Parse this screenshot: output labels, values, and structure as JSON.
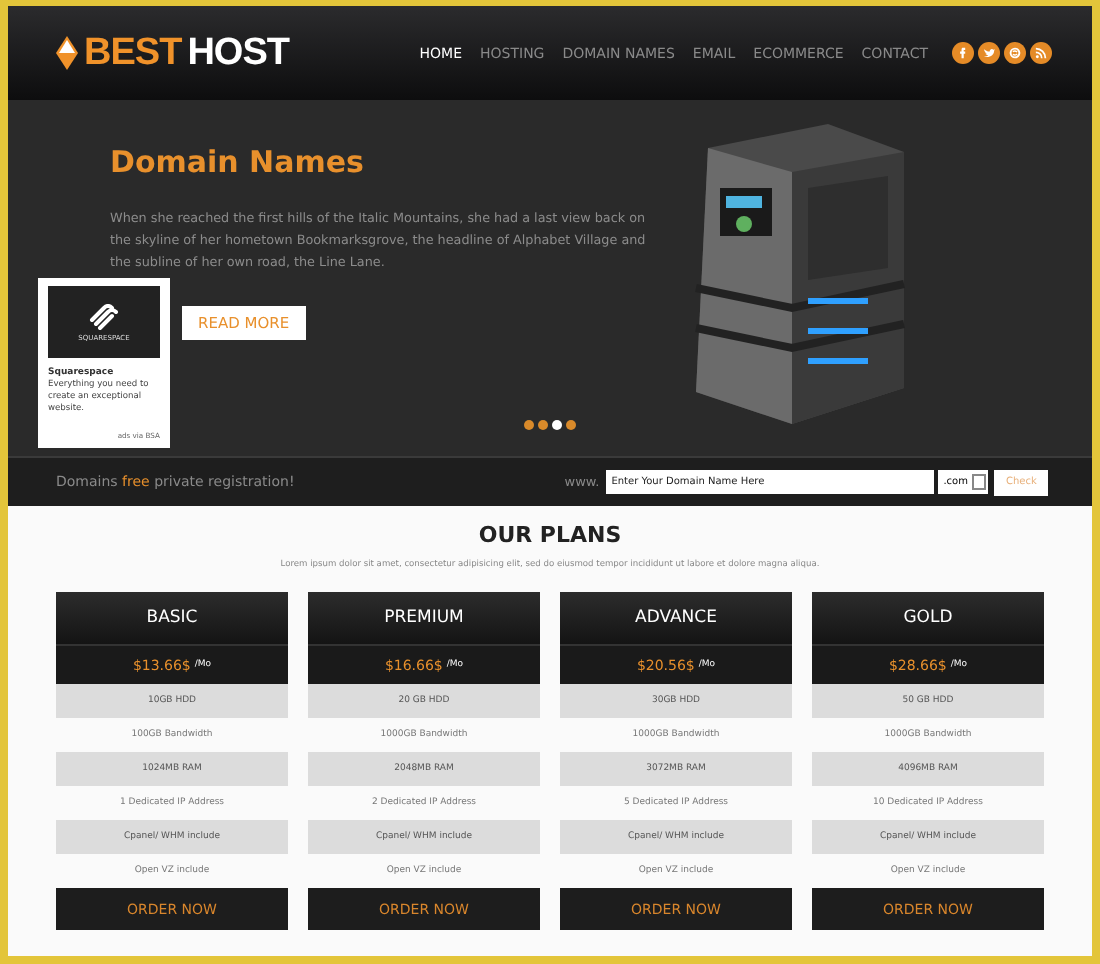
{
  "header": {
    "logo": {
      "accent": "BEST",
      "rest": "HOST"
    },
    "nav": [
      {
        "label": "HOME",
        "selected": true
      },
      {
        "label": "HOSTING",
        "selected": false
      },
      {
        "label": "DOMAIN NAMES",
        "selected": false
      },
      {
        "label": "EMAIL",
        "selected": false
      },
      {
        "label": "ECOMMERCE",
        "selected": false
      },
      {
        "label": "CONTACT",
        "selected": false
      }
    ],
    "social": [
      {
        "kind": "facebook"
      },
      {
        "kind": "twitter"
      },
      {
        "kind": "skype"
      },
      {
        "kind": "rss"
      }
    ]
  },
  "hero": {
    "title": "Domain Names",
    "text": "When she reached the first hills of the Italic Mountains, she had a last view back on the skyline of her hometown Bookmarksgrove, the headline of Alphabet Village and the subline of her own road, the Line Lane.",
    "button": "READ MORE",
    "dots": [
      {
        "selected": false
      },
      {
        "selected": false
      },
      {
        "selected": true
      },
      {
        "selected": false
      }
    ]
  },
  "ad": {
    "brand_mark": "SQUARESPACE",
    "title": "Squarespace",
    "text": "Everything you need to create an exceptional website.",
    "footer": "ads via BSA"
  },
  "domain_bar": {
    "text": "Domains **free** private registration!",
    "prefix": "www.",
    "placeholder": "Enter Your Domain Name Here",
    "tld": ".com",
    "button": "Check"
  },
  "plans_section": {
    "title": "OUR PLANS",
    "subtitle": "Lorem ipsum dolor sit amet, consectetur adipisicing elit, sed do eiusmod tempor incididunt ut labore et dolore magna aliqua.",
    "plans": [
      {
        "name": "BASIC",
        "price": "$13.66$",
        "period": "/Mo",
        "features": [
          {
            "kind": "shaded",
            "text": "10GB HDD"
          },
          {
            "kind": "plain",
            "text": "100GB Bandwidth"
          },
          {
            "kind": "shaded",
            "text": "1024MB RAM"
          },
          {
            "kind": "plain",
            "text": "1 Dedicated IP Address"
          },
          {
            "kind": "shaded",
            "text": "Cpanel/ WHM include"
          },
          {
            "kind": "plain",
            "text": "Open VZ include"
          }
        ],
        "button": "ORDER NOW"
      },
      {
        "name": "PREMIUM",
        "price": "$16.66$",
        "period": "/Mo",
        "features": [
          {
            "kind": "shaded",
            "text": "20 GB HDD"
          },
          {
            "kind": "plain",
            "text": "1000GB Bandwidth"
          },
          {
            "kind": "shaded",
            "text": "2048MB RAM"
          },
          {
            "kind": "plain",
            "text": "2 Dedicated IP Address"
          },
          {
            "kind": "shaded",
            "text": "Cpanel/ WHM include"
          },
          {
            "kind": "plain",
            "text": "Open VZ include"
          }
        ],
        "button": "ORDER NOW"
      },
      {
        "name": "ADVANCE",
        "price": "$20.56$",
        "period": "/Mo",
        "features": [
          {
            "kind": "shaded",
            "text": "30GB HDD"
          },
          {
            "kind": "plain",
            "text": "1000GB Bandwidth"
          },
          {
            "kind": "shaded",
            "text": "3072MB RAM"
          },
          {
            "kind": "plain",
            "text": "5 Dedicated IP Address"
          },
          {
            "kind": "shaded",
            "text": "Cpanel/ WHM include"
          },
          {
            "kind": "plain",
            "text": "Open VZ include"
          }
        ],
        "button": "ORDER NOW"
      },
      {
        "name": "GOLD",
        "price": "$28.66$",
        "period": "/Mo",
        "features": [
          {
            "kind": "shaded",
            "text": "50 GB HDD"
          },
          {
            "kind": "plain",
            "text": "1000GB Bandwidth"
          },
          {
            "kind": "shaded",
            "text": "4096MB RAM"
          },
          {
            "kind": "plain",
            "text": "10 Dedicated IP Address"
          },
          {
            "kind": "shaded",
            "text": "Cpanel/ WHM include"
          },
          {
            "kind": "plain",
            "text": "Open VZ include"
          }
        ],
        "button": "ORDER NOW"
      }
    ]
  }
}
